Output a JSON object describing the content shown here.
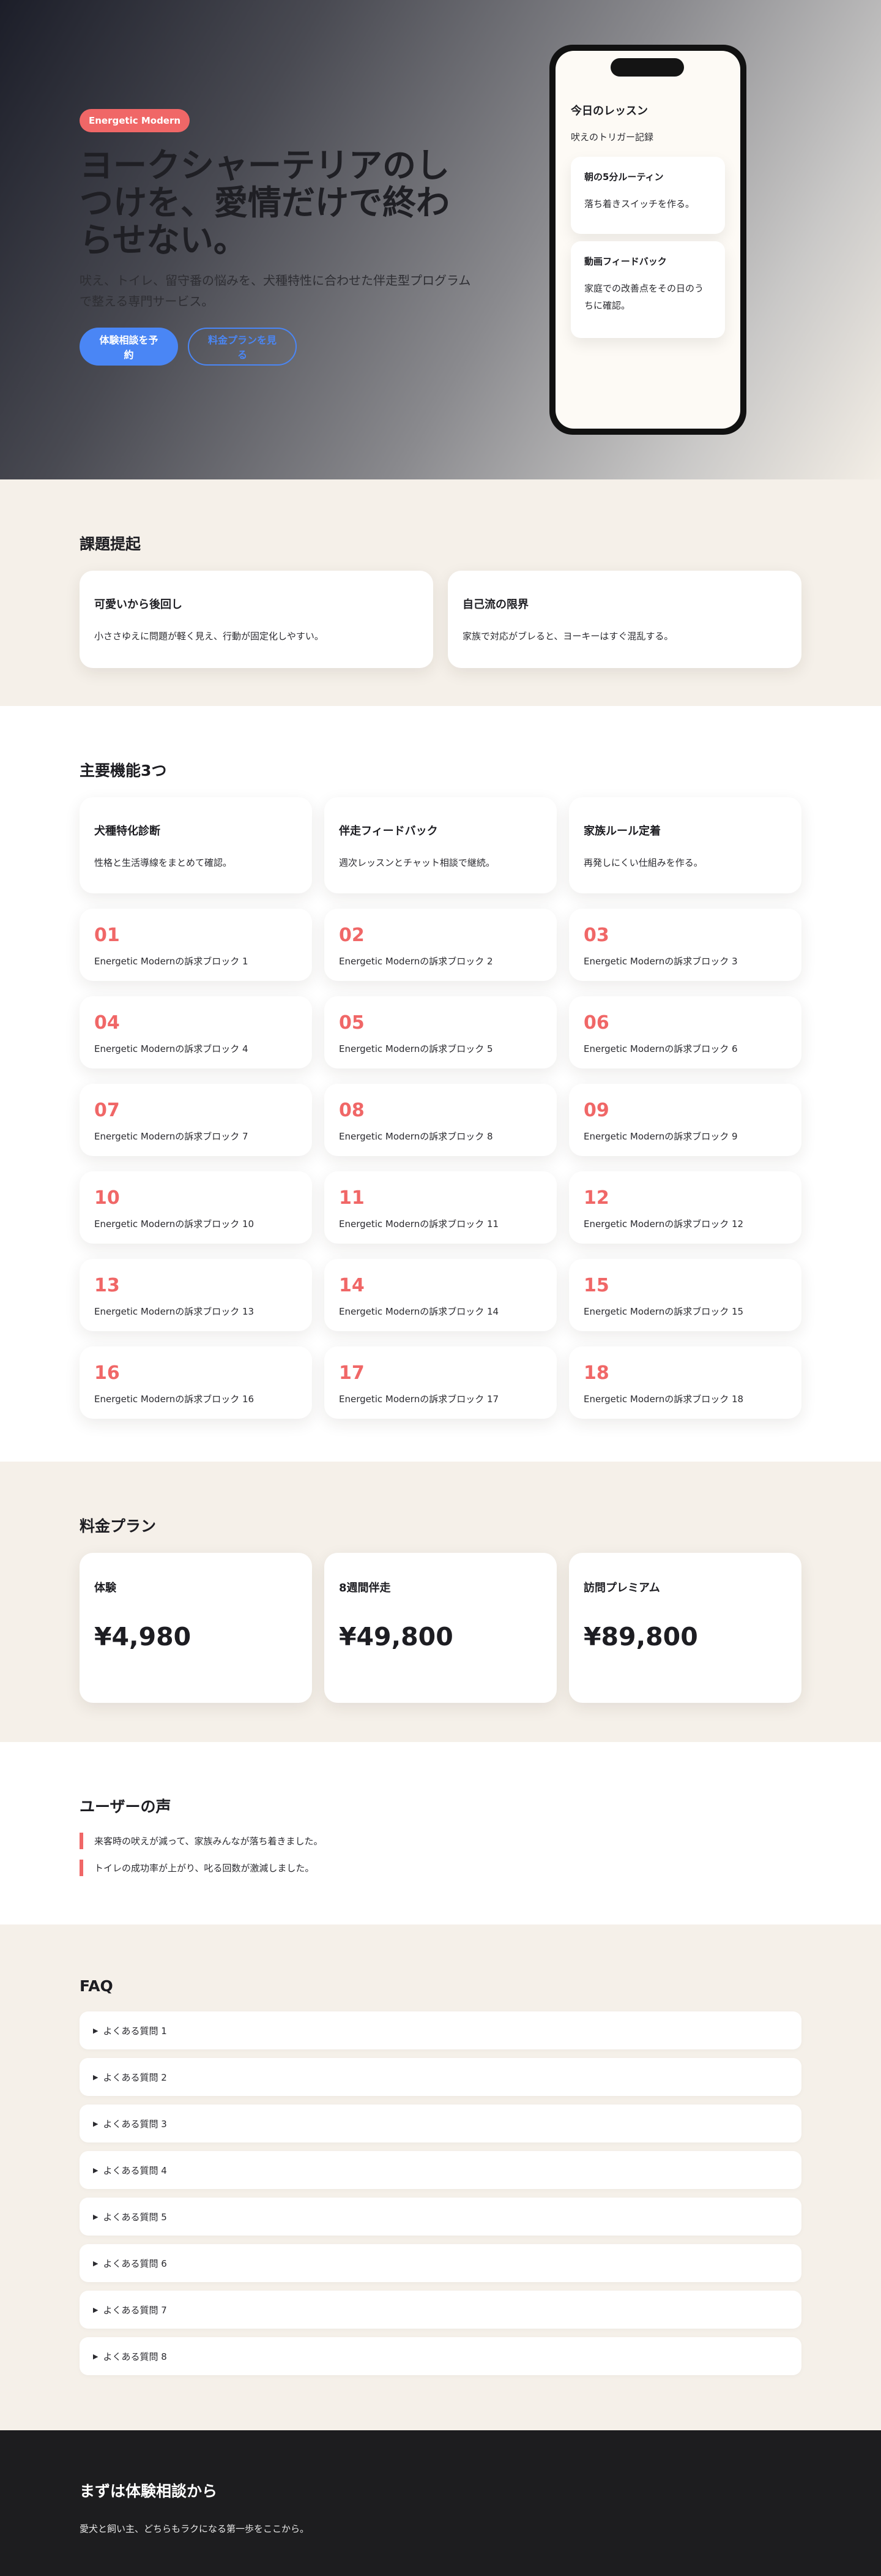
{
  "hero": {
    "badge": "Energetic Modern",
    "title": "ヨークシャーテリアのしつけを、愛情だけで終わらせない。",
    "subtitle": "吠え、トイレ、留守番の悩みを、犬種特性に合わせた伴走型プログラムで整える専門サービス。",
    "primary_button": "体験相談を予約",
    "secondary_button": "料金プランを見る",
    "phone": {
      "title": "今日のレッスン",
      "subtitle": "吠えのトリガー記録",
      "cards": [
        {
          "title": "朝の5分ルーティン",
          "text": "落ち着きスイッチを作る。"
        },
        {
          "title": "動画フィードバック",
          "text": "家庭での改善点をその日のうちに確認。"
        }
      ]
    }
  },
  "problems": {
    "title": "課題提起",
    "items": [
      {
        "title": "可愛いから後回し",
        "text": "小ささゆえに問題が軽く見え、行動が固定化しやすい。"
      },
      {
        "title": "自己流の限界",
        "text": "家族で対応がブレると、ヨーキーはすぐ混乱する。"
      }
    ]
  },
  "features": {
    "title": "主要機能3つ",
    "items": [
      {
        "title": "犬種特化診断",
        "text": "性格と生活導線をまとめて確認。"
      },
      {
        "title": "伴走フィードバック",
        "text": "週次レッスンとチャット相談で継続。"
      },
      {
        "title": "家族ルール定着",
        "text": "再発しにくい仕組みを作る。"
      }
    ],
    "blocks": [
      {
        "num": "01",
        "text": "Energetic Modernの訴求ブロック 1"
      },
      {
        "num": "02",
        "text": "Energetic Modernの訴求ブロック 2"
      },
      {
        "num": "03",
        "text": "Energetic Modernの訴求ブロック 3"
      },
      {
        "num": "04",
        "text": "Energetic Modernの訴求ブロック 4"
      },
      {
        "num": "05",
        "text": "Energetic Modernの訴求ブロック 5"
      },
      {
        "num": "06",
        "text": "Energetic Modernの訴求ブロック 6"
      },
      {
        "num": "07",
        "text": "Energetic Modernの訴求ブロック 7"
      },
      {
        "num": "08",
        "text": "Energetic Modernの訴求ブロック 8"
      },
      {
        "num": "09",
        "text": "Energetic Modernの訴求ブロック 9"
      },
      {
        "num": "10",
        "text": "Energetic Modernの訴求ブロック 10"
      },
      {
        "num": "11",
        "text": "Energetic Modernの訴求ブロック 11"
      },
      {
        "num": "12",
        "text": "Energetic Modernの訴求ブロック 12"
      },
      {
        "num": "13",
        "text": "Energetic Modernの訴求ブロック 13"
      },
      {
        "num": "14",
        "text": "Energetic Modernの訴求ブロック 14"
      },
      {
        "num": "15",
        "text": "Energetic Modernの訴求ブロック 15"
      },
      {
        "num": "16",
        "text": "Energetic Modernの訴求ブロック 16"
      },
      {
        "num": "17",
        "text": "Energetic Modernの訴求ブロック 17"
      },
      {
        "num": "18",
        "text": "Energetic Modernの訴求ブロック 18"
      }
    ]
  },
  "pricing": {
    "title": "料金プラン",
    "plans": [
      {
        "name": "体験",
        "price": "¥4,980"
      },
      {
        "name": "8週間伴走",
        "price": "¥49,800"
      },
      {
        "name": "訪問プレミアム",
        "price": "¥89,800"
      }
    ]
  },
  "voices": {
    "title": "ユーザーの声",
    "items": [
      "来客時の吠えが減って、家族みんなが落ち着きました。",
      "トイレの成功率が上がり、叱る回数が激減しました。"
    ]
  },
  "faq": {
    "title": "FAQ",
    "marker": "▶",
    "items": [
      "よくある質問 1",
      "よくある質問 2",
      "よくある質問 3",
      "よくある質問 4",
      "よくある質問 5",
      "よくある質問 6",
      "よくある質問 7",
      "よくある質問 8"
    ]
  },
  "cta": {
    "title": "まずは体験相談から",
    "text": "愛犬と飼い主、どちらもラクになる第一歩をここから。"
  },
  "colors": {
    "accent": "#f06767",
    "primary": "#4a86f5",
    "beige": "#f5f0e9",
    "dark": "#1d1d1f"
  }
}
